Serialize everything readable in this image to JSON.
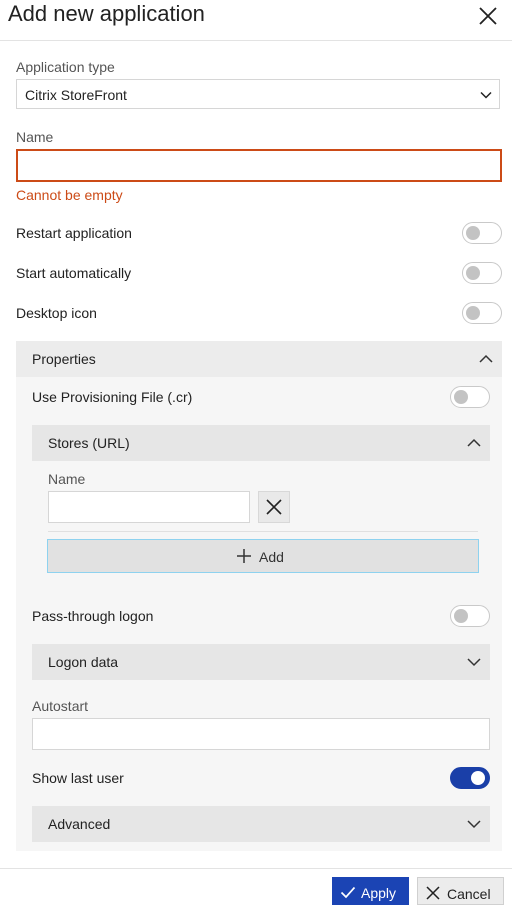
{
  "dialog": {
    "title": "Add new application"
  },
  "form": {
    "app_type_label": "Application type",
    "app_type_value": "Citrix StoreFront",
    "name_label": "Name",
    "name_value": "",
    "name_error": "Cannot be empty",
    "restart_label": "Restart application",
    "restart_on": false,
    "start_auto_label": "Start automatically",
    "start_auto_on": false,
    "desktop_icon_label": "Desktop icon",
    "desktop_icon_on": false
  },
  "properties": {
    "header": "Properties",
    "provisioning_label": "Use Provisioning File (.cr)",
    "provisioning_on": false,
    "stores": {
      "header": "Stores (URL)",
      "name_label": "Name",
      "name_value": "",
      "add_label": "Add"
    },
    "passthrough_label": "Pass-through logon",
    "passthrough_on": false,
    "logon_data_header": "Logon data",
    "autostart_label": "Autostart",
    "autostart_value": "",
    "show_last_user_label": "Show last user",
    "show_last_user_on": true,
    "advanced_header": "Advanced"
  },
  "footer": {
    "apply_label": "Apply",
    "cancel_label": "Cancel"
  },
  "colors": {
    "accent": "#1b44b4",
    "error": "#cc4b17",
    "focus": "#8ed2ef"
  }
}
